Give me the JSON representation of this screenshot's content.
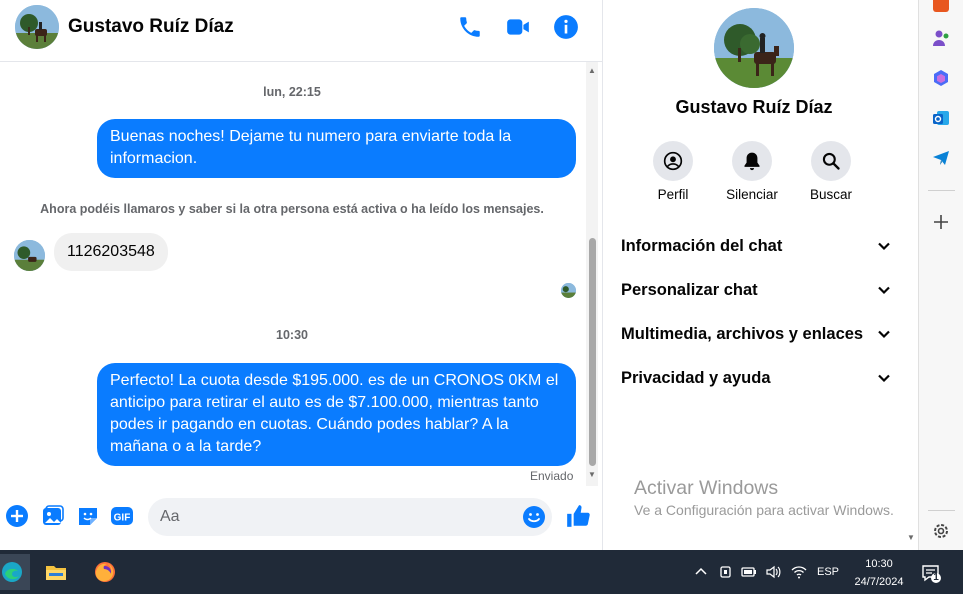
{
  "contact": {
    "name": "Gustavo Ruíz Díaz"
  },
  "header": {
    "icons": [
      "phone-icon",
      "video-icon",
      "info-icon"
    ]
  },
  "messages": {
    "time_1": "lun, 22:15",
    "out_1": "Buenas noches! Dejame tu numero para enviarte toda la informacion.",
    "notice": "Ahora podéis llamaros y saber si la otra persona está activa o ha leído los mensajes.",
    "in_1": "1126203548",
    "time_2": "10:30",
    "out_2": "Perfecto! La cuota desde $195.000. es de un CRONOS 0KM el anticipo para retirar el auto es de $7.100.000, mientras tanto podes ir pagando en cuotas. Cuándo podes hablar? A la mañana o a la tarde?",
    "status": "Enviado"
  },
  "composer": {
    "placeholder": "Aa"
  },
  "panel": {
    "name": "Gustavo Ruíz Díaz",
    "buttons": {
      "profile": "Perfil",
      "mute": "Silenciar",
      "search": "Buscar"
    },
    "sections": [
      "Información del chat",
      "Personalizar chat",
      "Multimedia, archivos y enlaces",
      "Privacidad y ayuda"
    ]
  },
  "watermark": {
    "title": "Activar Windows",
    "subtitle": "Ve a Configuración para activar Windows."
  },
  "taskbar": {
    "apps": [
      "edge-icon",
      "file-explorer-icon",
      "firefox-icon"
    ],
    "lang": "ESP",
    "time": "10:30",
    "date": "24/7/2024",
    "notification_count": "1"
  },
  "colors": {
    "accent": "#0a7cff",
    "bubble_in": "#f0f0f0",
    "taskbar": "#202a38"
  }
}
